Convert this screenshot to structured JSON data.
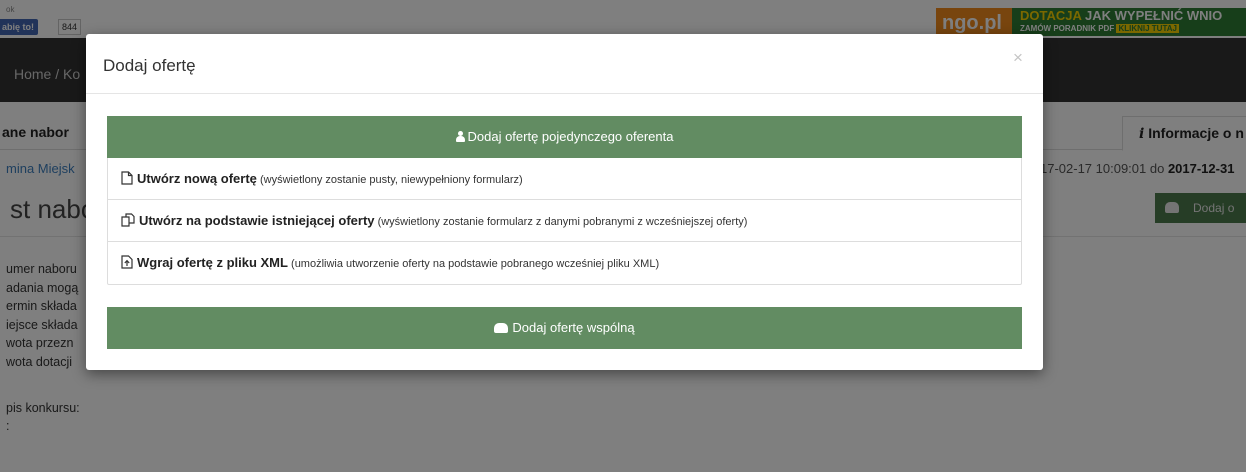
{
  "facebook": {
    "top_label": "ok",
    "like_label": "abię to!",
    "like_count": "844"
  },
  "ad": {
    "logo": "ngo.pl",
    "line1_a": "DOTACJA",
    "line1_b": "JAK WYPEŁNIĆ WNIO",
    "line2_a": "ZAMÓW PORADNIK PDF",
    "line2_b": "KLIKNIJ TUTAJ"
  },
  "navbar": {
    "breadcrumb": "Home / Ko"
  },
  "tabs": {
    "left": "ane nabor",
    "right": "Informacje o n"
  },
  "page": {
    "organization": "mina Miejsk",
    "dates_prefix": "17-02-17 10:09:01 do ",
    "dates_end": "2017-12-31",
    "title": "st nabor",
    "add_button": "Dodaj o"
  },
  "info_lines": [
    "umer naboru",
    "adania mogą",
    "ermin składa",
    "iejsce składa",
    "wota przezn",
    "wota dotacji"
  ],
  "description": {
    "label": "pis konkursu:",
    "extra": ":"
  },
  "modal": {
    "title": "Dodaj ofertę",
    "close": "×",
    "single_header": "Dodaj ofertę pojedynczego oferenta",
    "options": [
      {
        "title": "Utwórz nową ofertę",
        "hint": "(wyświetlony zostanie pusty, niewypełniony formularz)",
        "icon": "file-icon"
      },
      {
        "title": "Utwórz na podstawie istniejącej oferty",
        "hint": "(wyświetlony zostanie formularz z danymi pobranymi z wcześniejszej oferty)",
        "icon": "copy-icon"
      },
      {
        "title": "Wgraj ofertę z pliku XML",
        "hint": "(umożliwia utworzenie oferty na podstawie pobranego wcześniej pliku XML)",
        "icon": "file-upload-icon"
      }
    ],
    "joint_button": "Dodaj ofertę wspólną"
  },
  "colors": {
    "accent_green": "#628c62",
    "navbar": "#333333",
    "ad_orange": "#f08a1d",
    "ad_green": "#2e7d34"
  }
}
